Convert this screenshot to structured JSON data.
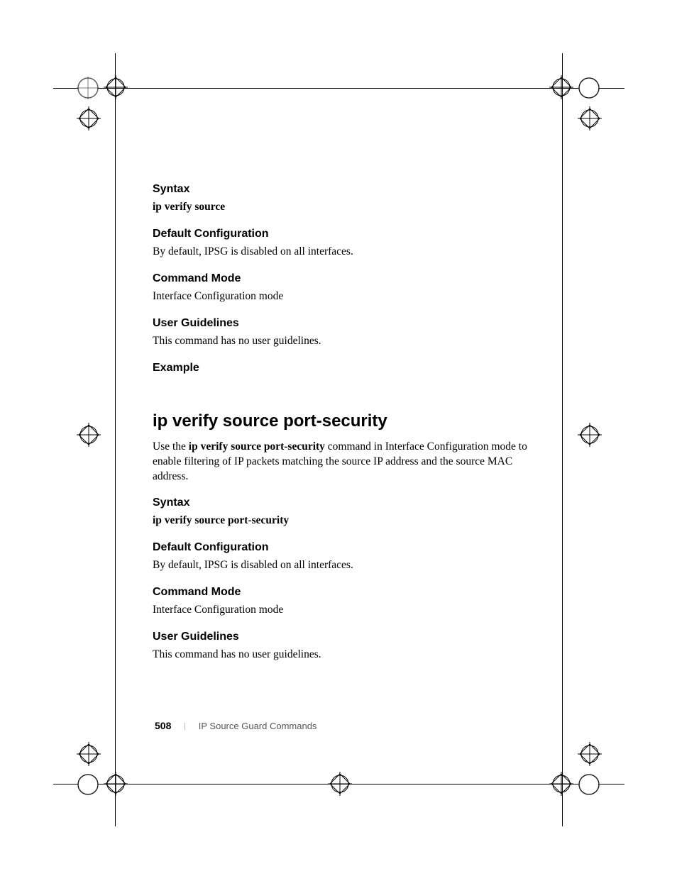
{
  "sections1": {
    "syntax": {
      "heading": "Syntax",
      "body": "ip verify source"
    },
    "default_config": {
      "heading": "Default Configuration",
      "body": "By default, IPSG is disabled on all interfaces."
    },
    "command_mode": {
      "heading": "Command Mode",
      "body": "Interface Configuration mode"
    },
    "user_guidelines": {
      "heading": "User Guidelines",
      "body": "This command has no user guidelines."
    },
    "example": {
      "heading": "Example"
    }
  },
  "main_heading": "ip verify source port-security",
  "intro": {
    "pre": "Use the ",
    "bold": "ip verify source port-security",
    "post": " command in Interface Configuration mode to enable filtering of IP packets matching the source IP address and the source MAC address."
  },
  "sections2": {
    "syntax": {
      "heading": "Syntax",
      "body": "ip verify source port-security"
    },
    "default_config": {
      "heading": "Default Configuration",
      "body": "By default, IPSG is disabled on all interfaces."
    },
    "command_mode": {
      "heading": "Command Mode",
      "body": "Interface Configuration mode"
    },
    "user_guidelines": {
      "heading": "User Guidelines",
      "body": "This command has no user guidelines."
    }
  },
  "footer": {
    "page": "508",
    "divider": "|",
    "chapter": "IP Source Guard Commands"
  }
}
